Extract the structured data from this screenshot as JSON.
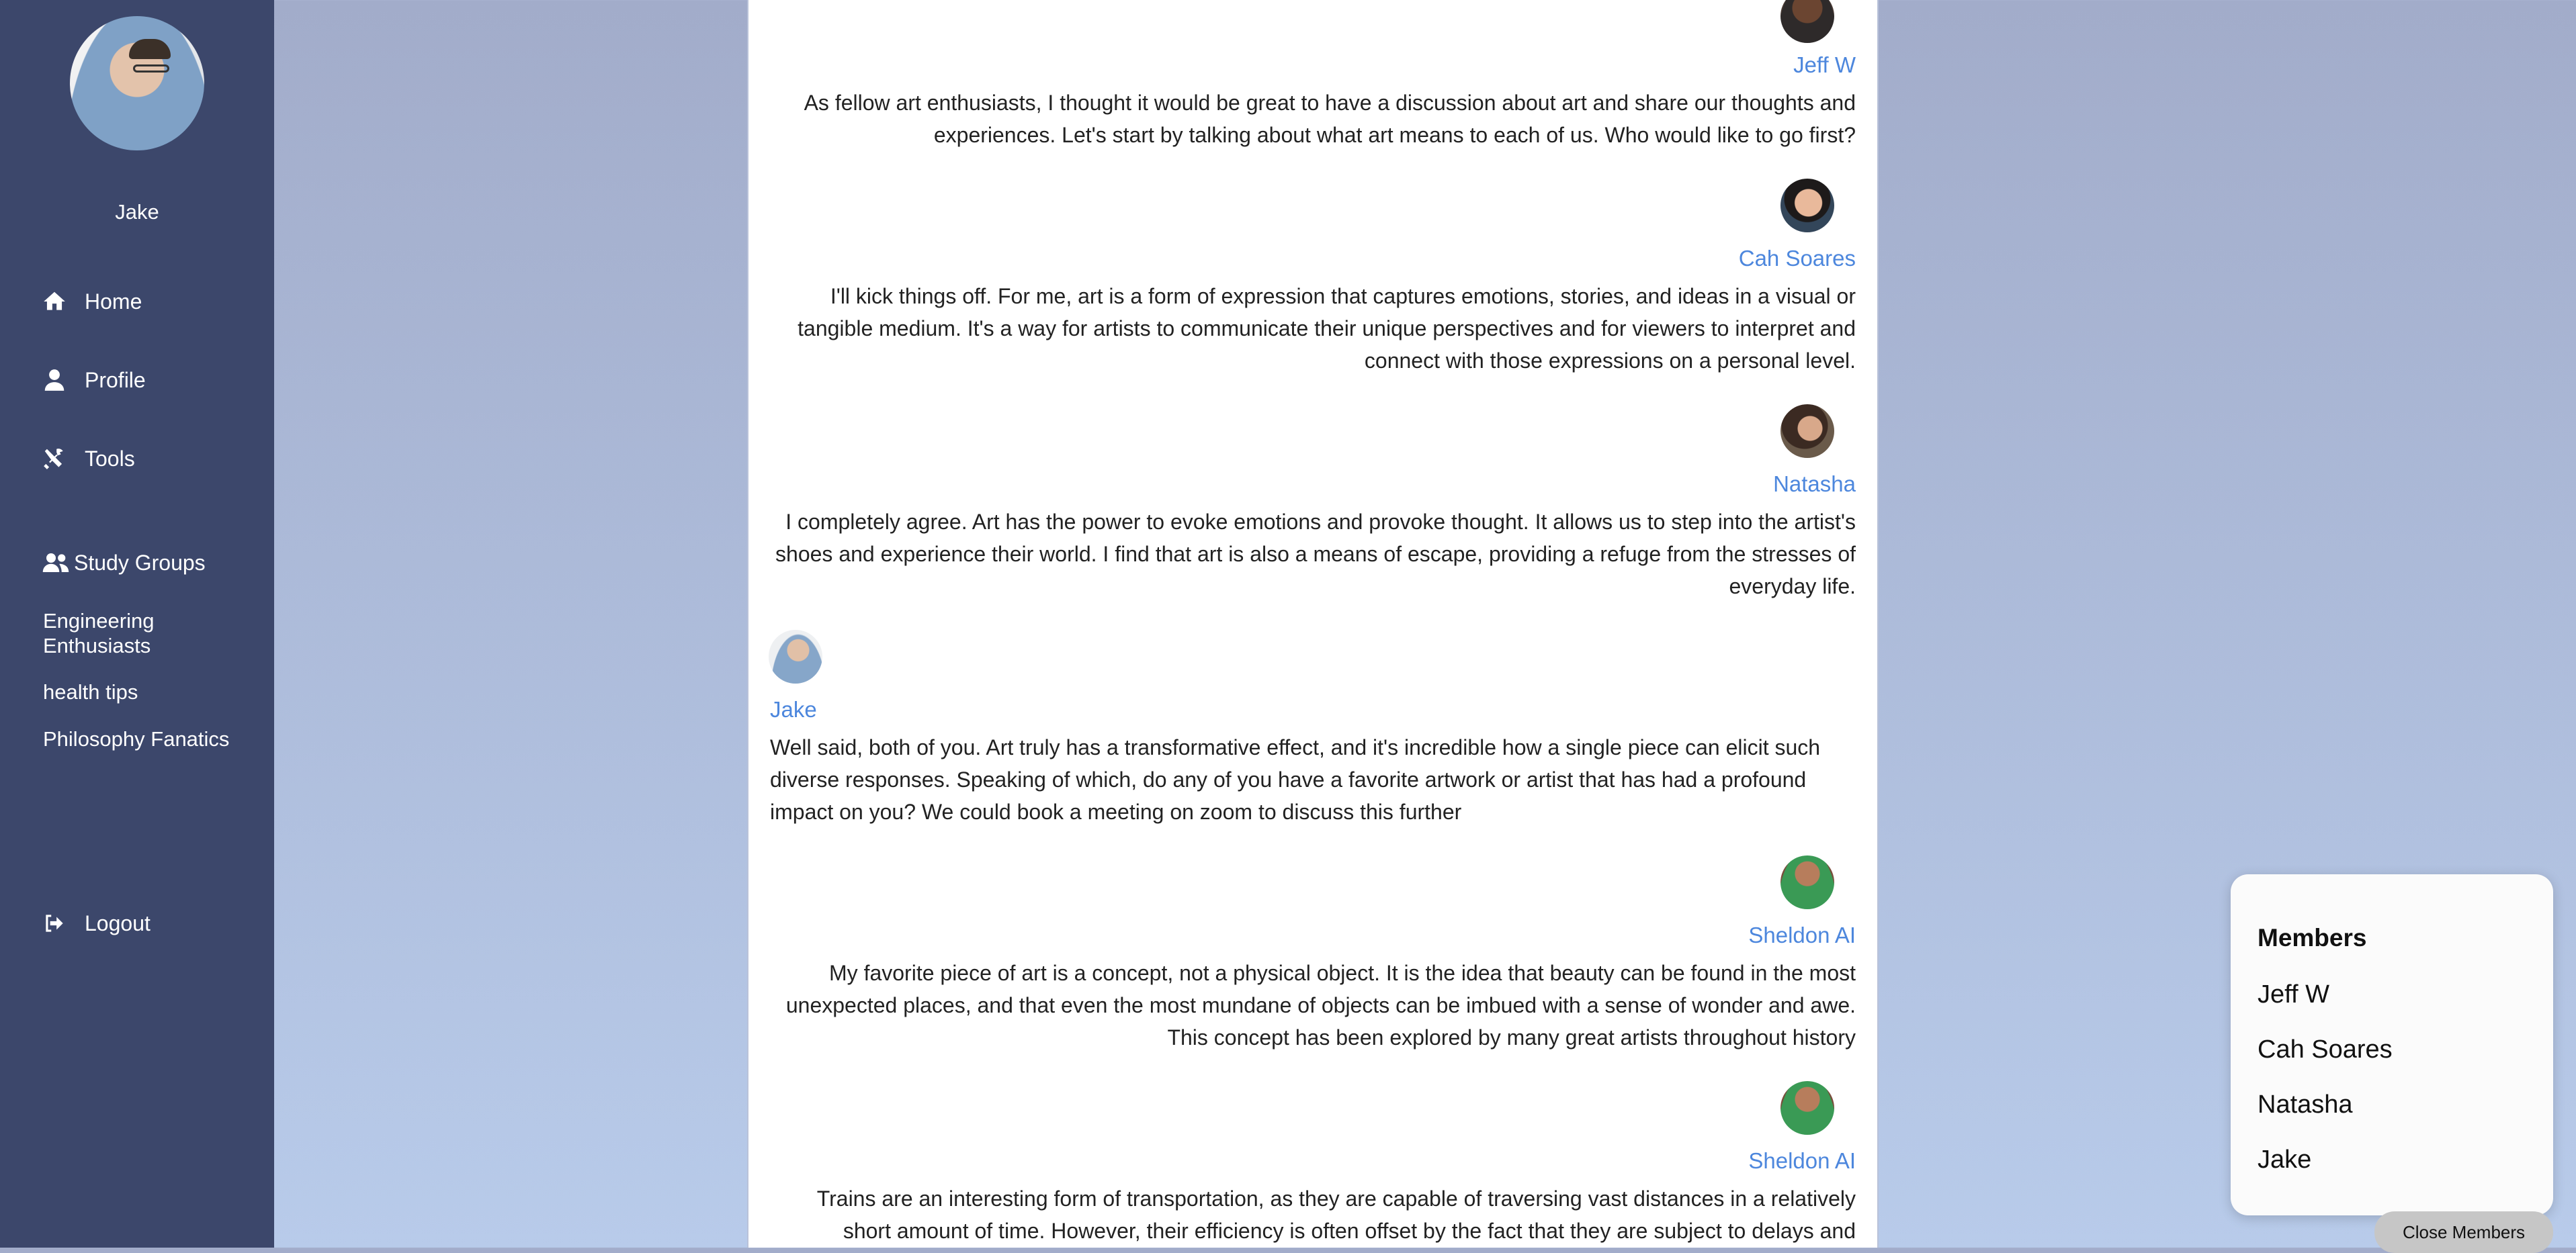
{
  "sidebar": {
    "username": "Jake",
    "nav": [
      {
        "label": "Home",
        "icon": "home-icon"
      },
      {
        "label": "Profile",
        "icon": "user-icon"
      },
      {
        "label": "Tools",
        "icon": "tools-icon"
      }
    ],
    "study_groups_label": "Study Groups",
    "groups": [
      "Engineering Enthusiasts",
      "health tips",
      "Philosophy Fanatics"
    ],
    "logout_label": "Logout"
  },
  "chat": {
    "messages": [
      {
        "author": "Jeff W",
        "align": "right",
        "text": "As fellow art enthusiasts, I thought it would be great to have a discussion about art and share our thoughts and experiences. Let's start by talking about what art means to each of us. Who would like to go first?"
      },
      {
        "author": "Cah Soares",
        "align": "right",
        "text": "I'll kick things off. For me, art is a form of expression that captures emotions, stories, and ideas in a visual or tangible medium. It's a way for artists to communicate their unique perspectives and for viewers to interpret and connect with those expressions on a personal level."
      },
      {
        "author": "Natasha",
        "align": "right",
        "text": "I completely agree. Art has the power to evoke emotions and provoke thought. It allows us to step into the artist's shoes and experience their world. I find that art is also a means of escape, providing a refuge from the stresses of everyday life."
      },
      {
        "author": "Jake",
        "align": "left",
        "text": "Well said, both of you. Art truly has a transformative effect, and it's incredible how a single piece can elicit such diverse responses. Speaking of which, do any of you have a favorite artwork or artist that has had a profound impact on you? We could book a meeting on zoom to discuss this further"
      },
      {
        "author": "Sheldon AI",
        "align": "right",
        "text": "My favorite piece of art is a concept, not a physical object. It is the idea that beauty can be found in the most unexpected places, and that even the most mundane of objects can be imbued with a sense of wonder and awe. This concept has been explored by many great artists throughout history"
      },
      {
        "author": "Sheldon AI",
        "align": "right",
        "text": "Trains are an interesting form of transportation, as they are capable of traversing vast distances in a relatively short amount of time. However, their efficiency is often offset by the fact that they are subject to delays and"
      }
    ]
  },
  "members_panel": {
    "title": "Members",
    "members": [
      "Jeff W",
      "Cah Soares",
      "Natasha",
      "Jake"
    ],
    "close_label": "Close Members"
  },
  "colors": {
    "sidebar_bg": "#3c476b",
    "author_name": "#4d87dd",
    "background_gradient_top": "#a2acca",
    "background_gradient_bottom": "#b8cbea"
  }
}
